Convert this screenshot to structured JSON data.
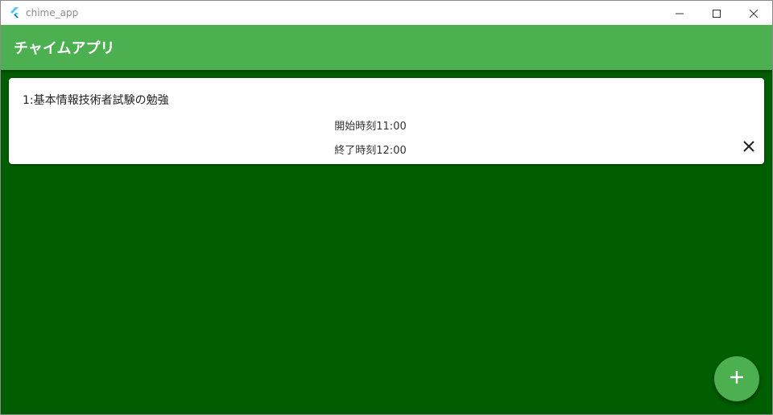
{
  "window": {
    "title": "chime_app",
    "controls": [
      "minimize-icon",
      "maximize-icon",
      "close-icon"
    ]
  },
  "appbar": {
    "title": "チャイムアプリ",
    "color": "#4caf50"
  },
  "body": {
    "background": "#005e00"
  },
  "items": [
    {
      "title": "1:基本情報技術者試験の勉強",
      "start": "開始時刻11:00",
      "end": "終了時刻12:00",
      "delete_icon": "close-icon"
    }
  ],
  "fab": {
    "icon": "add-icon"
  }
}
